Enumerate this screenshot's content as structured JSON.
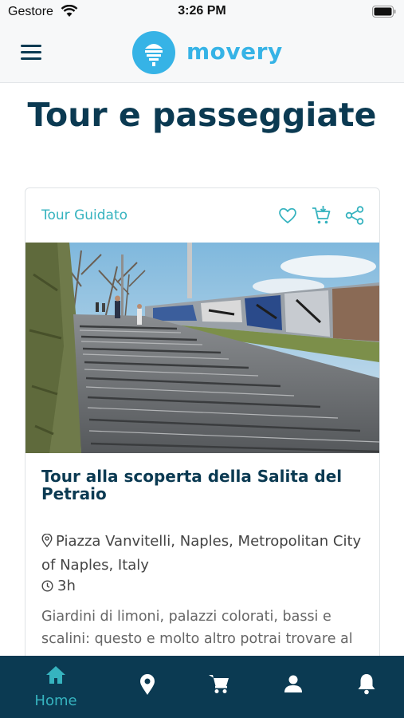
{
  "status_bar": {
    "carrier": "Gestore",
    "time": "3:26 PM",
    "icons": [
      "wifi-icon",
      "battery-icon"
    ]
  },
  "header": {
    "brand": "movery",
    "menu_icon": "hamburger-menu-icon",
    "logo_icon": "movery-logo-icon",
    "brand_color": "#36b3e6"
  },
  "page": {
    "title": "Tour e passeggiate"
  },
  "card": {
    "category": "Tour Guidato",
    "actions": [
      "heart-icon",
      "cart-add-icon",
      "share-icon"
    ],
    "image": "photo of a stone stairway with graffiti wall",
    "title": "Tour alla scoperta della Salita del Petraio",
    "location": "Piazza Vanvitelli, Naples, Metropolitan City of Naples, Italy",
    "duration": "3h",
    "description": "Giardini di limoni, palazzi colorati, bassi e scalini: questo e molto altro potrai trovare al"
  },
  "bottom_nav": {
    "items": [
      {
        "label": "Home",
        "icon": "home-icon",
        "active": true
      },
      {
        "label": "",
        "icon": "map-pin-icon",
        "active": false
      },
      {
        "label": "",
        "icon": "cart-icon",
        "active": false
      },
      {
        "label": "",
        "icon": "user-icon",
        "active": false
      },
      {
        "label": "",
        "icon": "bell-icon",
        "active": false
      }
    ],
    "background": "#0b3a52",
    "active_color": "#36b3bf"
  }
}
